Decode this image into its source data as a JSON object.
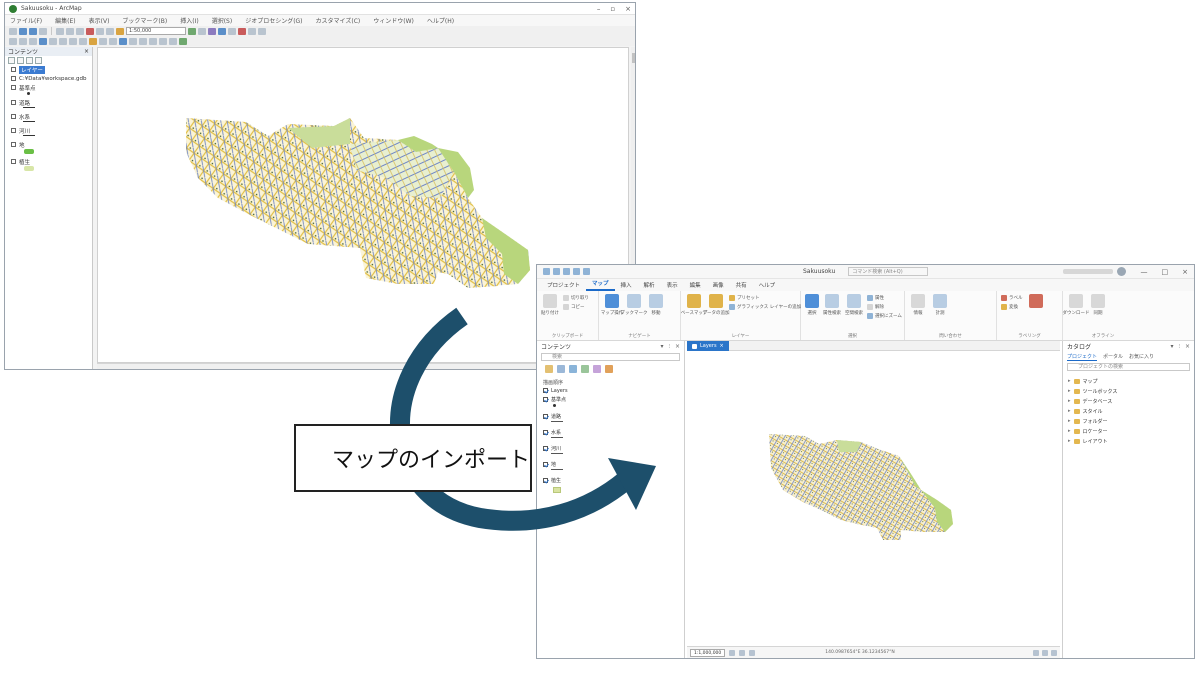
{
  "callout": {
    "label": "マップのインポート",
    "icon": "import-map-icon"
  },
  "colors": {
    "arrow": "#1d4f6b",
    "accent": "#1b6ac9",
    "map_yellow": "#e6c34b",
    "map_blue": "#6f86c6",
    "map_green": "#b8d67c"
  },
  "arcmap": {
    "title": "Sakuusoku - ArcMap",
    "menu": [
      "ファイル(F)",
      "編集(E)",
      "表示(V)",
      "ブックマーク(B)",
      "挿入(I)",
      "選択(S)",
      "ジオプロセシング(G)",
      "カスタマイズ(C)",
      "ウィンドウ(W)",
      "ヘルプ(H)"
    ],
    "scale_value": "1:50,000",
    "toc": {
      "title": "コンテンツ",
      "close": "×",
      "items": [
        {
          "label": "レイヤー",
          "selected": true
        },
        {
          "label": "C:¥Data¥workspace.gdb"
        },
        {
          "label": "基準点"
        },
        {
          "label": "道路"
        },
        {
          "label": "水系"
        },
        {
          "label": "河川"
        },
        {
          "label": "地"
        },
        {
          "label": "植生"
        }
      ]
    }
  },
  "pro": {
    "project_name": "Sakuusoku",
    "command_search": "コマンド検索 (Alt+Q)",
    "window_controls": [
      "—",
      "□",
      "×"
    ],
    "tabs": [
      "プロジェクト",
      "マップ",
      "挿入",
      "解析",
      "表示",
      "編集",
      "画像",
      "共有",
      "ヘルプ"
    ],
    "active_tab": "マップ",
    "groups": {
      "clipboard": {
        "label": "クリップボード",
        "paste": "貼り付け",
        "cut": "切り取り",
        "copy": "コピー"
      },
      "navigate": {
        "label": "ナビゲート",
        "explore": "マップ操作",
        "fixed": "固定",
        "bookmark": "ブックマーク",
        "goto": "移動"
      },
      "layer": {
        "label": "レイヤー",
        "add_data": "データの追加",
        "add_preset": "プリセット",
        "basemap": "ベースマップ",
        "add_graphics": "グラフィックス レイヤーの追加"
      },
      "selection": {
        "label": "選択",
        "select": "選択",
        "by_attr": "属性検索",
        "by_loc": "空間検索",
        "attributes": "属性",
        "clear": "解除",
        "zoom_to": "選択にズーム"
      },
      "inquiry": {
        "label": "問い合わせ",
        "explore": "情報",
        "measure": "計測"
      },
      "labeling": {
        "label": "ラベリング",
        "convert": "変換",
        "more": "ラベル"
      },
      "offline": {
        "label": "オフライン",
        "download": "ダウンロード",
        "sync": "同期"
      }
    },
    "contents": {
      "title": "コンテンツ",
      "search_placeholder": "検索",
      "subtitle": "描画順序",
      "items": [
        "Layers",
        "基準点",
        "道路",
        "水系",
        "河川",
        "地",
        "植生"
      ]
    },
    "map_tab": "Layers",
    "map_scale": "1:1,000,000",
    "coordinates": "140.0987654°E 36.1234567°N",
    "catalog": {
      "title": "カタログ",
      "tabs": [
        "プロジェクト",
        "ポータル",
        "お気に入り"
      ],
      "search_placeholder": "プロジェクトの検索",
      "items": [
        "マップ",
        "ツールボックス",
        "データベース",
        "スタイル",
        "フォルダー",
        "ロケーター",
        "レイアウト"
      ]
    }
  }
}
